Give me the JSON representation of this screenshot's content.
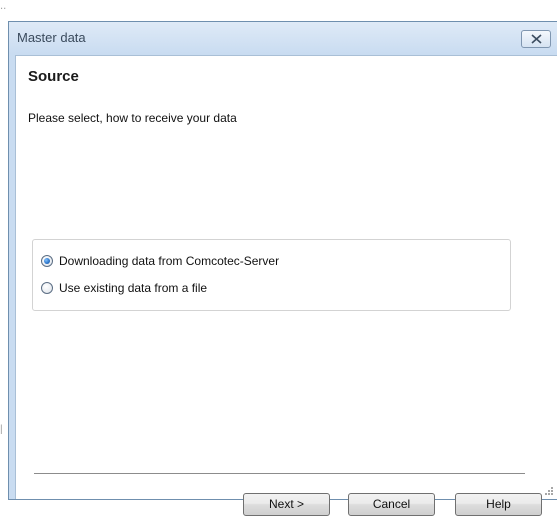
{
  "window": {
    "title": "Master data"
  },
  "page": {
    "heading": "Source",
    "description": "Please select, how to receive your data"
  },
  "options": [
    {
      "label": "Downloading data from Comcotec-Server",
      "selected": true
    },
    {
      "label": "Use existing data from a file",
      "selected": false
    }
  ],
  "buttons": {
    "next": "Next >",
    "cancel": "Cancel",
    "help": "Help"
  },
  "icons": {
    "close": "close-icon",
    "resize_grip": "resize-grip-icon"
  },
  "colors": {
    "window_frame": "#c9dcf1",
    "radio_selected": "#2b74c7"
  }
}
